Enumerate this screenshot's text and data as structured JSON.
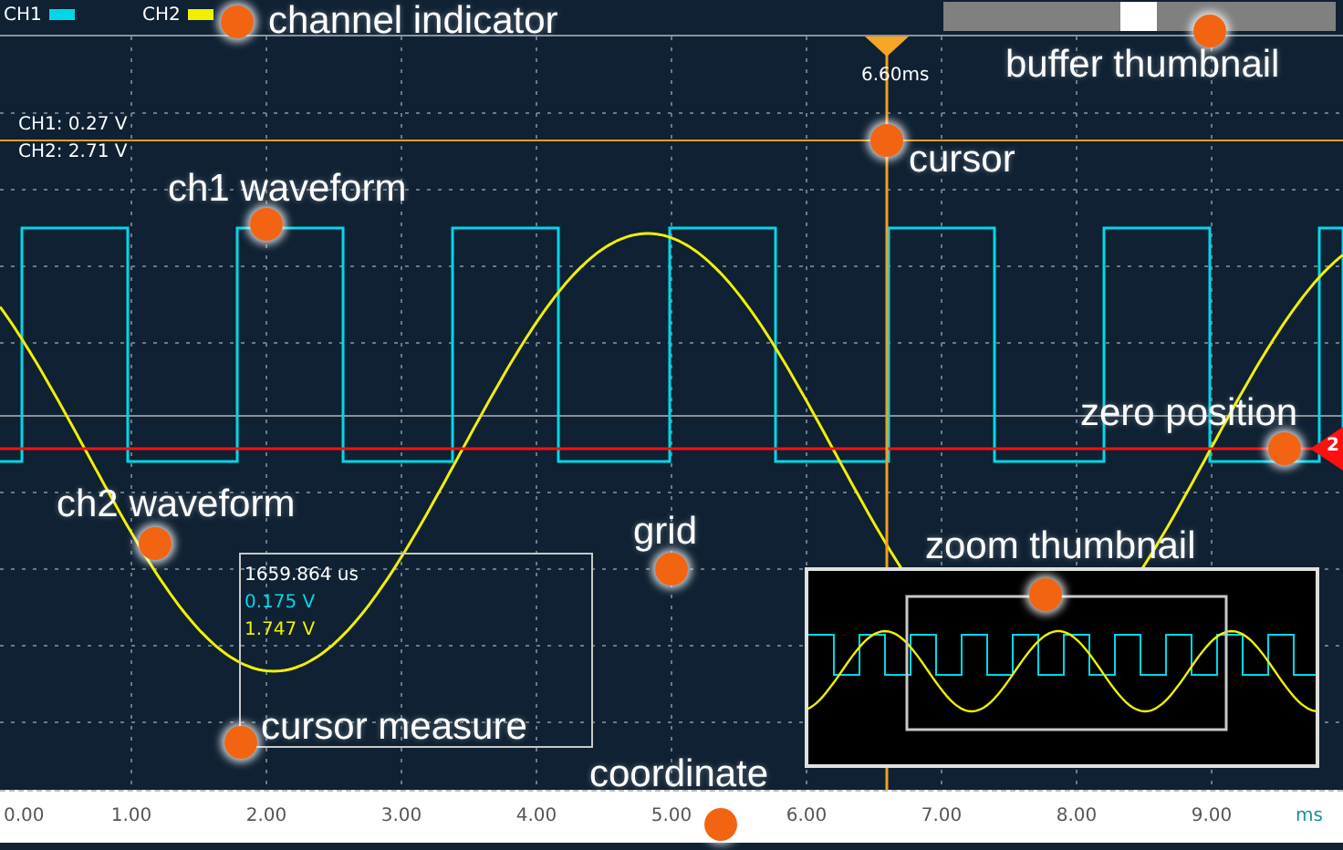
{
  "channels": [
    {
      "label": "CH1",
      "color": "#00d8e8"
    },
    {
      "label": "CH2",
      "color": "#f0f000"
    }
  ],
  "cursor": {
    "time": "6.60ms",
    "readings": [
      "CH1: 0.27 V",
      "CH2: 2.71 V"
    ]
  },
  "zero_marker": {
    "label": "2"
  },
  "cursor_measure": {
    "lines": [
      {
        "text": "1659.864 us",
        "color": "#ffffff"
      },
      {
        "text": "0.175 V",
        "color": "#00d8e8"
      },
      {
        "text": "1.747 V",
        "color": "#f0f000"
      }
    ]
  },
  "time_axis": {
    "ticks": [
      "0.00",
      "1.00",
      "2.00",
      "3.00",
      "4.00",
      "5.00",
      "6.00",
      "7.00",
      "8.00",
      "9.00"
    ],
    "unit": "ms"
  },
  "annotations": [
    {
      "text": "channel indicator"
    },
    {
      "text": "buffer thumbnail"
    },
    {
      "text": "cursor"
    },
    {
      "text": "ch1 waveform"
    },
    {
      "text": "zero position"
    },
    {
      "text": "ch2 waveform"
    },
    {
      "text": "grid"
    },
    {
      "text": "zoom thumbnail"
    },
    {
      "text": "cursor measure"
    },
    {
      "text": "coordinate"
    }
  ]
}
